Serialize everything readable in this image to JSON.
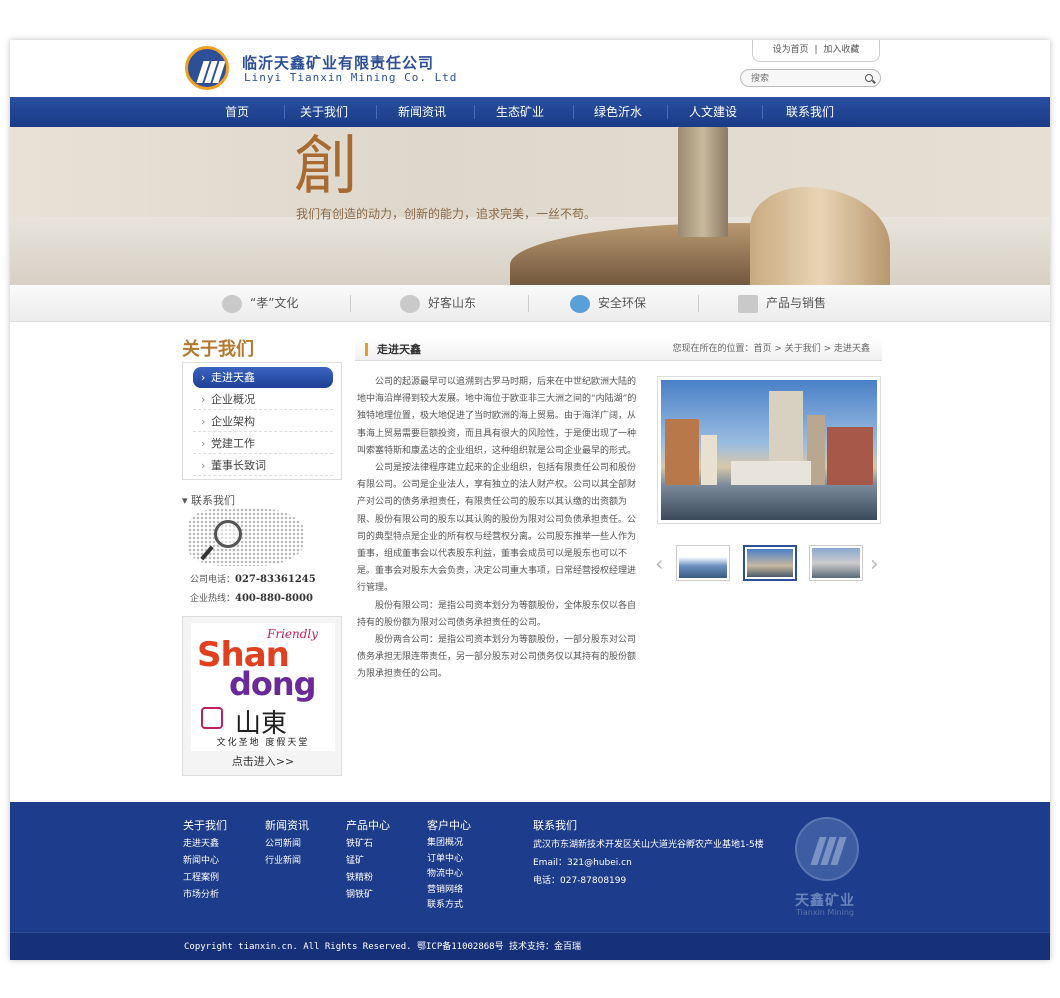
{
  "header": {
    "company_cn": "临沂天鑫矿业有限责任公司",
    "company_en": "Linyi Tianxin Mining Co. Ltd",
    "set_home": "设为首页",
    "link_sep": "|",
    "add_favorite": "加入收藏",
    "search_placeholder": "搜索"
  },
  "nav": [
    "首页",
    "关于我们",
    "新闻资讯",
    "生态矿业",
    "绿色沂水",
    "人文建设",
    "联系我们"
  ],
  "banner": {
    "glyph": "創",
    "slogan": "我们有创造的动力，创新的能力，追求完美，一丝不苟。"
  },
  "features": [
    "“孝”文化",
    "好客山东",
    "安全环保",
    "产品与销售"
  ],
  "sidebar": {
    "title": "关于我们",
    "menu": [
      "走进天鑫",
      "企业概况",
      "企业架构",
      "党建工作",
      "董事长致词"
    ],
    "contact_title": "联系我们",
    "phone_label": "公司电话：",
    "phone": "027-83361245",
    "hotline_label": "企业热线：",
    "hotline": "400-880-8000",
    "sd_enter": "点击进入>>",
    "sd_friendly": "Friendly",
    "sd_shan": "Shan",
    "sd_dong": "dong",
    "sd_cn": "山東",
    "sd_tag": "文化圣地  度假天堂"
  },
  "content": {
    "title": "走进天鑫",
    "breadcrumb": "您现在所在的位置：首页 > 关于我们 > 走进天鑫",
    "paragraphs": [
      "公司的起源最早可以追溯到古罗马时期，后来在中世纪欧洲大陆的地中海沿岸得到较大发展。地中海位于欧亚非三大洲之间的“内陆湖”的独特地理位置，极大地促进了当时欧洲的海上贸易。由于海洋广阔，从事海上贸易需要巨额投资，而且具有很大的风险性，于是便出现了一种叫索塞特斯和康孟达的企业组织，这种组织就是公司企业最早的形式。",
      "公司是按法律程序建立起来的企业组织，包括有限责任公司和股份有限公司。公司是企业法人，享有独立的法人财产权。公司以其全部财产对公司的债务承担责任，有限责任公司的股东以其认缴的出资额为限、股份有限公司的股东以其认购的股份为限对公司负债承担责任。公司的典型特点是企业的所有权与经营权分离。公司股东推举一些人作为董事，组成董事会以代表股东利益，董事会成员可以是股东也可以不是。董事会对股东大会负责，决定公司重大事项，日常经营授权经理进行管理。",
      "股份有限公司：是指公司资本划分为等额股份，全体股东仅以各自持有的股份额为限对公司债务承担责任的公司。",
      "股份两合公司：是指公司资本划分为等额股份，一部分股东对公司债务承担无限连带责任，另一部分股东对公司债务仅以其持有的股份额为限承担责任的公司。"
    ]
  },
  "footer": {
    "cols": [
      {
        "h": "关于我们",
        "items": [
          "走进天鑫",
          "新闻中心",
          "工程案例",
          "市场分析"
        ]
      },
      {
        "h": "新闻资讯",
        "items": [
          "公司新闻",
          "行业新闻"
        ]
      },
      {
        "h": "产品中心",
        "items": [
          "铁矿石",
          "锰矿",
          "铁精粉",
          "钢铁矿"
        ]
      },
      {
        "h": "客户中心",
        "items": [
          "集团概况",
          "订单中心",
          "物流中心",
          "营销网络",
          "联系方式"
        ]
      },
      {
        "h": "联系我们",
        "items": [
          "武汉市东湖新技术开发区关山大道光谷孵农产业基地1-5楼",
          "Email：321@hubei.cn",
          "电话：027-87808199"
        ]
      }
    ],
    "logo_cn": "天鑫矿业",
    "logo_en": "Tianxin Mining",
    "copyright": "Copyright tianxin.cn. All Rights Reserved.   鄂ICP备11002868号   技术支持：金百瑞"
  }
}
